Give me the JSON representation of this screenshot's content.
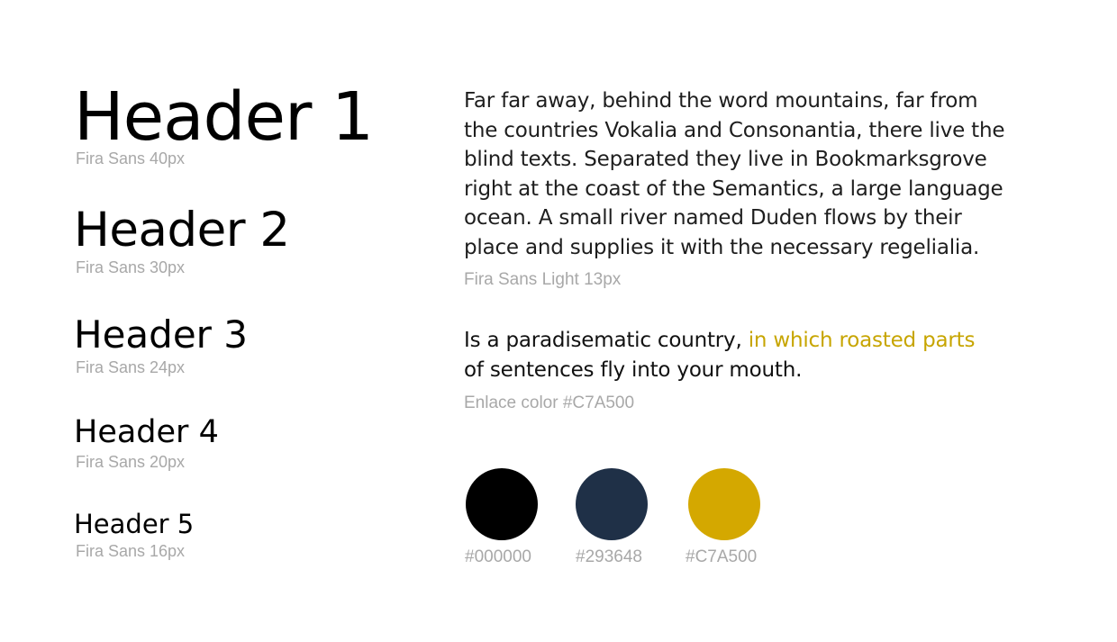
{
  "headers": [
    {
      "label": "Header 1",
      "caption": "Fira Sans 40px"
    },
    {
      "label": "Header 2",
      "caption": "Fira Sans 30px"
    },
    {
      "label": "Header 3",
      "caption": "Fira Sans 24px"
    },
    {
      "label": "Header 4",
      "caption": "Fira Sans 20px"
    },
    {
      "label": "Header 5",
      "caption": "Fira Sans 16px"
    }
  ],
  "body_text": {
    "lines": [
      "Far far away, behind the word mountains, far from",
      "the countries Vokalia and Consonantia, there live the",
      "blind texts. Separated they live in Bookmarksgrove",
      "right at the coast of the Semantics, a large language",
      "ocean. A small river named Duden flows by their",
      "place and supplies it with the necessary regelialia."
    ],
    "caption": "Fira Sans Light 13px"
  },
  "link_sample": {
    "line1_plain": "Is a paradisematic country, ",
    "line1_accent": "in which roasted parts",
    "line2_plain": "of sentences fly into your mouth.",
    "caption": "Enlace color #C7A500"
  },
  "palette": [
    {
      "hex": "#000000",
      "label": "#000000"
    },
    {
      "hex": "#1F3047",
      "label": "#293648"
    },
    {
      "hex": "#D4A800",
      "label": "#C7A500"
    }
  ],
  "colors": {
    "accent": "#C7A500",
    "caption_gray": "#A8A8A8",
    "text": "#1E1E1E"
  }
}
